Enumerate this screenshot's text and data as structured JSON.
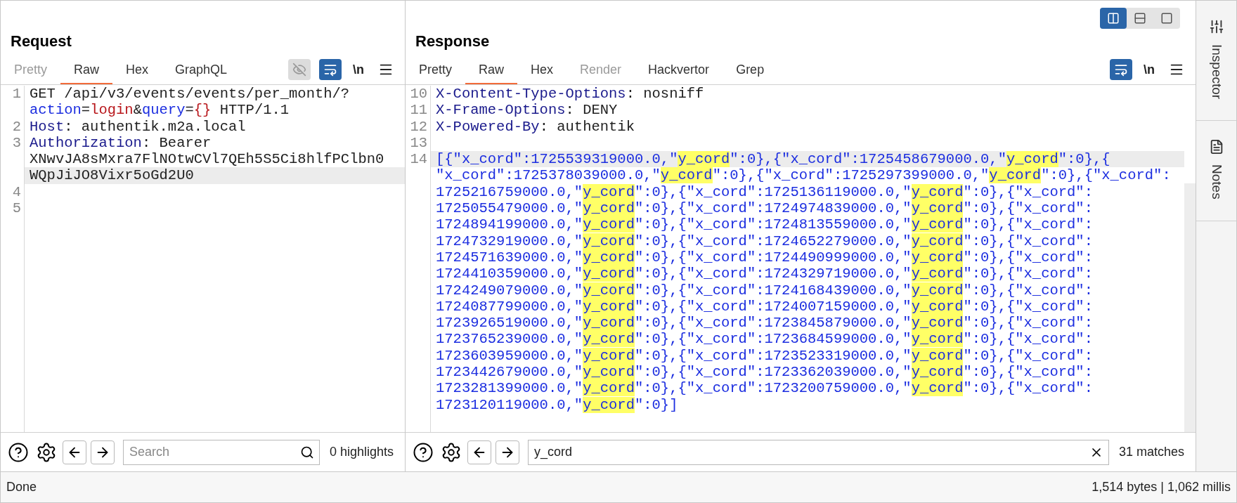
{
  "request": {
    "title": "Request",
    "tabs": [
      {
        "label": "Pretty",
        "selected": false,
        "disabled": true
      },
      {
        "label": "Raw",
        "selected": true,
        "disabled": false
      },
      {
        "label": "Hex",
        "selected": false,
        "disabled": false
      },
      {
        "label": "GraphQL",
        "selected": false,
        "disabled": false
      }
    ],
    "toolbar": [
      {
        "kind": "eye",
        "disabled": true
      },
      {
        "kind": "wrap",
        "on": true,
        "disabled": false
      },
      {
        "kind": "newline",
        "label": "\\n",
        "on": false,
        "disabled": false
      },
      {
        "kind": "menu"
      }
    ],
    "lines": [
      {
        "number": "1",
        "rows": [
          {
            "current": false,
            "tokens": [
              {
                "text": "GET /api/v3/events/events/per_month/?",
                "kind": "text"
              }
            ]
          },
          {
            "current": false,
            "tokens": [
              {
                "text": "action",
                "kind": "param"
              },
              {
                "text": "=",
                "kind": "text"
              },
              {
                "text": "login",
                "kind": "value"
              },
              {
                "text": "&",
                "kind": "text"
              },
              {
                "text": "query",
                "kind": "param"
              },
              {
                "text": "=",
                "kind": "text"
              },
              {
                "text": "{}",
                "kind": "value"
              },
              {
                "text": " HTTP/1.1",
                "kind": "text"
              }
            ]
          }
        ]
      },
      {
        "number": "2",
        "rows": [
          {
            "current": false,
            "tokens": [
              {
                "text": "Host",
                "kind": "header"
              },
              {
                "text": ": authentik.m2a.local",
                "kind": "text"
              }
            ]
          }
        ]
      },
      {
        "number": "3",
        "rows": [
          {
            "current": false,
            "tokens": [
              {
                "text": "Authorization",
                "kind": "header"
              },
              {
                "text": ": Bearer",
                "kind": "text"
              }
            ]
          },
          {
            "current": false,
            "tokens": [
              {
                "text": "XNwvJA8sMxra7FlNOtwCVl7QEh5S5Ci8hlfPClbn0",
                "kind": "text"
              }
            ]
          },
          {
            "current": true,
            "tokens": [
              {
                "text": "WQpJiJO8Vixr5oGd2U0",
                "kind": "text"
              }
            ]
          }
        ]
      },
      {
        "number": "4",
        "rows": [
          {
            "current": false,
            "tokens": []
          }
        ]
      },
      {
        "number": "5",
        "rows": [
          {
            "current": false,
            "tokens": []
          }
        ]
      }
    ],
    "search": {
      "placeholder": "Search",
      "result": "0 highlights"
    }
  },
  "response": {
    "title": "Response",
    "layout_buttons": [
      {
        "kind": "columns",
        "selected": true
      },
      {
        "kind": "rows",
        "selected": false
      },
      {
        "kind": "single",
        "selected": false
      }
    ],
    "tabs": [
      {
        "label": "Pretty",
        "selected": false,
        "disabled": false
      },
      {
        "label": "Raw",
        "selected": true,
        "disabled": false
      },
      {
        "label": "Hex",
        "selected": false,
        "disabled": false
      },
      {
        "label": "Render",
        "selected": false,
        "disabled": true
      },
      {
        "label": "Hackvertor",
        "selected": false,
        "disabled": false
      },
      {
        "label": "Grep",
        "selected": false,
        "disabled": false
      }
    ],
    "toolbar": [
      {
        "kind": "wrap",
        "on": true,
        "disabled": false
      },
      {
        "kind": "newline",
        "label": "\\n",
        "on": false,
        "disabled": false
      },
      {
        "kind": "menu"
      }
    ],
    "lines": [
      {
        "number": "10",
        "rows": [
          {
            "current": false,
            "tokens": [
              {
                "text": "X-Content-Type-Options",
                "kind": "header"
              },
              {
                "text": ": nosniff",
                "kind": "text"
              }
            ]
          }
        ]
      },
      {
        "number": "11",
        "rows": [
          {
            "current": false,
            "tokens": [
              {
                "text": "X-Frame-Options",
                "kind": "header"
              },
              {
                "text": ": DENY",
                "kind": "text"
              }
            ]
          }
        ]
      },
      {
        "number": "12",
        "rows": [
          {
            "current": false,
            "tokens": [
              {
                "text": "X-Powered-By",
                "kind": "header"
              },
              {
                "text": ": authentik",
                "kind": "text"
              }
            ]
          }
        ]
      },
      {
        "number": "13",
        "rows": [
          {
            "current": false,
            "tokens": []
          }
        ]
      },
      {
        "number": "14",
        "rows": [
          {
            "current": true,
            "tokens": [
              {
                "text": "[{\"x_cord\":1725539319000.0,\"",
                "kind": "json"
              },
              {
                "text": "y_cord",
                "kind": "match"
              },
              {
                "text": "\":0},{\"x_cord\":1725458679000.0,\"",
                "kind": "json"
              },
              {
                "text": "y_cord",
                "kind": "match"
              },
              {
                "text": "\":0},{",
                "kind": "json"
              }
            ]
          },
          {
            "current": false,
            "tokens": [
              {
                "text": "\"x_cord\":1725378039000.0,\"",
                "kind": "json"
              },
              {
                "text": "y_cord",
                "kind": "match"
              },
              {
                "text": "\":0},{\"x_cord\":1725297399000.0,\"",
                "kind": "json"
              },
              {
                "text": "y_cord",
                "kind": "match"
              },
              {
                "text": "\":0},{\"x_cord\":",
                "kind": "json"
              }
            ]
          },
          {
            "current": false,
            "tokens": [
              {
                "text": "1725216759000.0,\"",
                "kind": "json"
              },
              {
                "text": "y_cord",
                "kind": "match"
              },
              {
                "text": "\":0},{\"x_cord\":1725136119000.0,\"",
                "kind": "json"
              },
              {
                "text": "y_cord",
                "kind": "match"
              },
              {
                "text": "\":0},{\"x_cord\":",
                "kind": "json"
              }
            ]
          },
          {
            "current": false,
            "tokens": [
              {
                "text": "1725055479000.0,\"",
                "kind": "json"
              },
              {
                "text": "y_cord",
                "kind": "match"
              },
              {
                "text": "\":0},{\"x_cord\":1724974839000.0,\"",
                "kind": "json"
              },
              {
                "text": "y_cord",
                "kind": "match"
              },
              {
                "text": "\":0},{\"x_cord\":",
                "kind": "json"
              }
            ]
          },
          {
            "current": false,
            "tokens": [
              {
                "text": "1724894199000.0,\"",
                "kind": "json"
              },
              {
                "text": "y_cord",
                "kind": "match"
              },
              {
                "text": "\":0},{\"x_cord\":1724813559000.0,\"",
                "kind": "json"
              },
              {
                "text": "y_cord",
                "kind": "match"
              },
              {
                "text": "\":0},{\"x_cord\":",
                "kind": "json"
              }
            ]
          },
          {
            "current": false,
            "tokens": [
              {
                "text": "1724732919000.0,\"",
                "kind": "json"
              },
              {
                "text": "y_cord",
                "kind": "match"
              },
              {
                "text": "\":0},{\"x_cord\":1724652279000.0,\"",
                "kind": "json"
              },
              {
                "text": "y_cord",
                "kind": "match"
              },
              {
                "text": "\":0},{\"x_cord\":",
                "kind": "json"
              }
            ]
          },
          {
            "current": false,
            "tokens": [
              {
                "text": "1724571639000.0,\"",
                "kind": "json"
              },
              {
                "text": "y_cord",
                "kind": "match"
              },
              {
                "text": "\":0},{\"x_cord\":1724490999000.0,\"",
                "kind": "json"
              },
              {
                "text": "y_cord",
                "kind": "match"
              },
              {
                "text": "\":0},{\"x_cord\":",
                "kind": "json"
              }
            ]
          },
          {
            "current": false,
            "tokens": [
              {
                "text": "1724410359000.0,\"",
                "kind": "json"
              },
              {
                "text": "y_cord",
                "kind": "match"
              },
              {
                "text": "\":0},{\"x_cord\":1724329719000.0,\"",
                "kind": "json"
              },
              {
                "text": "y_cord",
                "kind": "match"
              },
              {
                "text": "\":0},{\"x_cord\":",
                "kind": "json"
              }
            ]
          },
          {
            "current": false,
            "tokens": [
              {
                "text": "1724249079000.0,\"",
                "kind": "json"
              },
              {
                "text": "y_cord",
                "kind": "match"
              },
              {
                "text": "\":0},{\"x_cord\":1724168439000.0,\"",
                "kind": "json"
              },
              {
                "text": "y_cord",
                "kind": "match"
              },
              {
                "text": "\":0},{\"x_cord\":",
                "kind": "json"
              }
            ]
          },
          {
            "current": false,
            "tokens": [
              {
                "text": "1724087799000.0,\"",
                "kind": "json"
              },
              {
                "text": "y_cord",
                "kind": "match"
              },
              {
                "text": "\":0},{\"x_cord\":1724007159000.0,\"",
                "kind": "json"
              },
              {
                "text": "y_cord",
                "kind": "match"
              },
              {
                "text": "\":0},{\"x_cord\":",
                "kind": "json"
              }
            ]
          },
          {
            "current": false,
            "tokens": [
              {
                "text": "1723926519000.0,\"",
                "kind": "json"
              },
              {
                "text": "y_cord",
                "kind": "match"
              },
              {
                "text": "\":0},{\"x_cord\":1723845879000.0,\"",
                "kind": "json"
              },
              {
                "text": "y_cord",
                "kind": "match"
              },
              {
                "text": "\":0},{\"x_cord\":",
                "kind": "json"
              }
            ]
          },
          {
            "current": false,
            "tokens": [
              {
                "text": "1723765239000.0,\"",
                "kind": "json"
              },
              {
                "text": "y_cord",
                "kind": "match"
              },
              {
                "text": "\":0},{\"x_cord\":1723684599000.0,\"",
                "kind": "json"
              },
              {
                "text": "y_cord",
                "kind": "match"
              },
              {
                "text": "\":0},{\"x_cord\":",
                "kind": "json"
              }
            ]
          },
          {
            "current": false,
            "tokens": [
              {
                "text": "1723603959000.0,\"",
                "kind": "json"
              },
              {
                "text": "y_cord",
                "kind": "match"
              },
              {
                "text": "\":0},{\"x_cord\":1723523319000.0,\"",
                "kind": "json"
              },
              {
                "text": "y_cord",
                "kind": "match"
              },
              {
                "text": "\":0},{\"x_cord\":",
                "kind": "json"
              }
            ]
          },
          {
            "current": false,
            "tokens": [
              {
                "text": "1723442679000.0,\"",
                "kind": "json"
              },
              {
                "text": "y_cord",
                "kind": "match"
              },
              {
                "text": "\":0},{\"x_cord\":1723362039000.0,\"",
                "kind": "json"
              },
              {
                "text": "y_cord",
                "kind": "match"
              },
              {
                "text": "\":0},{\"x_cord\":",
                "kind": "json"
              }
            ]
          },
          {
            "current": false,
            "tokens": [
              {
                "text": "1723281399000.0,\"",
                "kind": "json"
              },
              {
                "text": "y_cord",
                "kind": "match"
              },
              {
                "text": "\":0},{\"x_cord\":1723200759000.0,\"",
                "kind": "json"
              },
              {
                "text": "y_cord",
                "kind": "match"
              },
              {
                "text": "\":0},{\"x_cord\":",
                "kind": "json"
              }
            ]
          },
          {
            "current": false,
            "tokens": [
              {
                "text": "1723120119000.0,\"",
                "kind": "json"
              },
              {
                "text": "y_cord",
                "kind": "match"
              },
              {
                "text": "\":0}]",
                "kind": "json"
              }
            ]
          }
        ]
      }
    ],
    "search": {
      "value": "y_cord",
      "result": "31 matches"
    }
  },
  "sidebar": {
    "items": [
      {
        "kind": "inspector",
        "label": "Inspector"
      },
      {
        "kind": "notes",
        "label": "Notes"
      }
    ]
  },
  "status_bar": {
    "left": "Done",
    "right": "1,514 bytes | 1,062 millis"
  }
}
